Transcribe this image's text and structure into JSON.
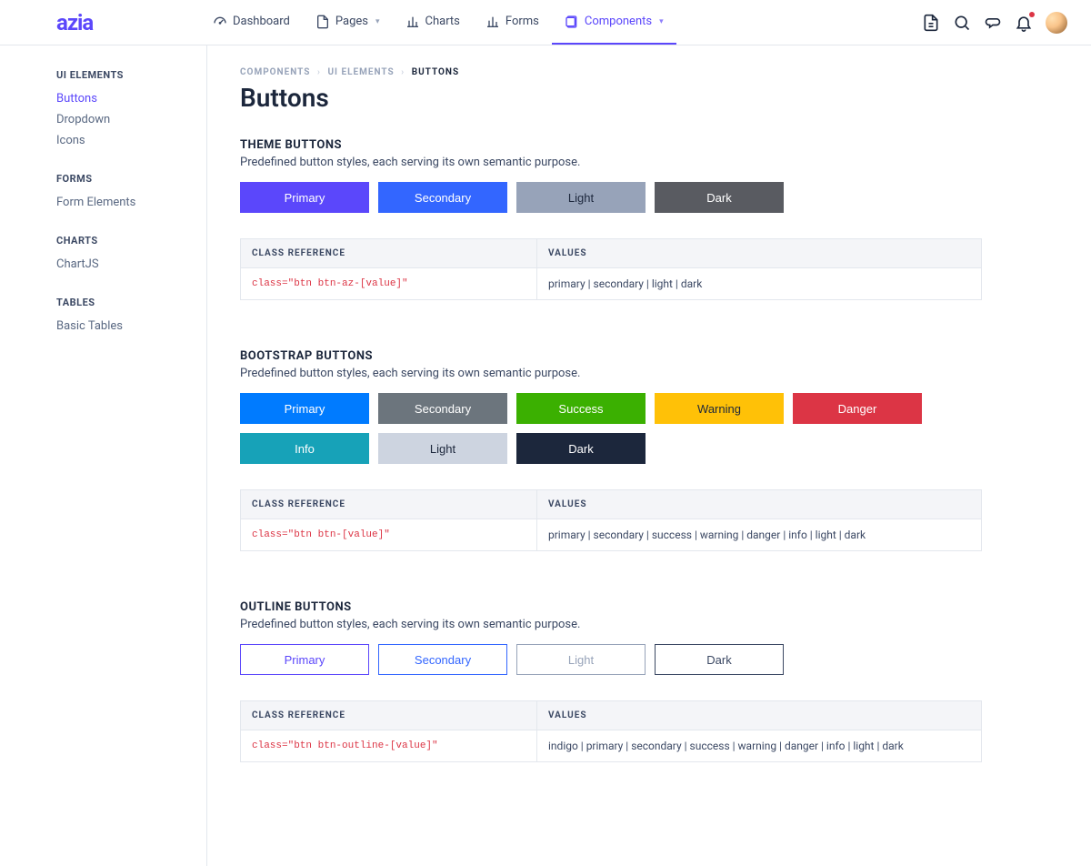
{
  "brand": "azia",
  "nav": {
    "items": [
      {
        "label": "Dashboard",
        "has_caret": false
      },
      {
        "label": "Pages",
        "has_caret": true
      },
      {
        "label": "Charts",
        "has_caret": false
      },
      {
        "label": "Forms",
        "has_caret": false
      },
      {
        "label": "Components",
        "has_caret": true,
        "active": true
      }
    ]
  },
  "sidebar": {
    "groups": [
      {
        "title": "UI ELEMENTS",
        "links": [
          {
            "label": "Buttons",
            "active": true
          },
          {
            "label": "Dropdown"
          },
          {
            "label": "Icons"
          }
        ]
      },
      {
        "title": "FORMS",
        "links": [
          {
            "label": "Form Elements"
          }
        ]
      },
      {
        "title": "CHARTS",
        "links": [
          {
            "label": "ChartJS"
          }
        ]
      },
      {
        "title": "TABLES",
        "links": [
          {
            "label": "Basic Tables"
          }
        ]
      }
    ]
  },
  "crumbs": {
    "a": "COMPONENTS",
    "b": "UI ELEMENTS",
    "c": "BUTTONS"
  },
  "page_title": "Buttons",
  "table_headers": {
    "ref": "CLASS REFERENCE",
    "vals": "VALUES"
  },
  "sections": {
    "theme": {
      "title": "THEME BUTTONS",
      "desc": "Predefined button styles, each serving its own semantic purpose.",
      "buttons": {
        "primary": "Primary",
        "secondary": "Secondary",
        "light": "Light",
        "dark": "Dark"
      },
      "codeRef": "class=\"btn btn-az-[value]\"",
      "values": "primary | secondary | light | dark"
    },
    "bootstrap": {
      "title": "BOOTSTRAP BUTTONS",
      "desc": "Predefined button styles, each serving its own semantic purpose.",
      "buttons": {
        "primary": "Primary",
        "secondary": "Secondary",
        "success": "Success",
        "warning": "Warning",
        "danger": "Danger",
        "info": "Info",
        "light": "Light",
        "dark": "Dark"
      },
      "codeRef": "class=\"btn btn-[value]\"",
      "values": "primary | secondary | success | warning | danger | info | light | dark"
    },
    "outline": {
      "title": "OUTLINE BUTTONS",
      "desc": "Predefined button styles, each serving its own semantic purpose.",
      "buttons": {
        "primary": "Primary",
        "secondary": "Secondary",
        "light": "Light",
        "dark": "Dark"
      },
      "codeRef": "class=\"btn btn-outline-[value]\"",
      "values": "indigo | primary | secondary | success | warning | danger | info | light | dark"
    }
  }
}
